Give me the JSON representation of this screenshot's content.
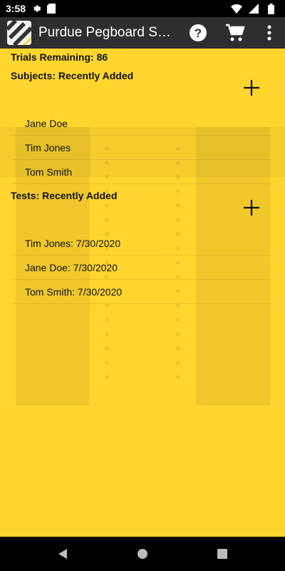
{
  "status_bar": {
    "time": "3:58",
    "icons": [
      "settings-icon",
      "sd-card-icon",
      "wifi-icon",
      "cell-signal-icon",
      "battery-icon"
    ]
  },
  "app_bar": {
    "title": "Purdue Pegboard Sco...",
    "actions": [
      "help-icon",
      "cart-icon",
      "overflow-menu-icon"
    ],
    "background": "#2e2e2e"
  },
  "main": {
    "trials_label": "Trials Remaining: 86",
    "subjects": {
      "title": "Subjects: Recently Added",
      "items": [
        "Jane Doe",
        "Tim Jones",
        "Tom Smith"
      ]
    },
    "tests": {
      "title": "Tests: Recently Added",
      "items": [
        "Tim Jones: 7/30/2020",
        "Jane Doe: 7/30/2020",
        "Tom Smith: 7/30/2020"
      ]
    },
    "background": "#ffd52e"
  },
  "nav_bar": {
    "buttons": [
      "back-icon",
      "home-icon",
      "recents-icon"
    ]
  }
}
